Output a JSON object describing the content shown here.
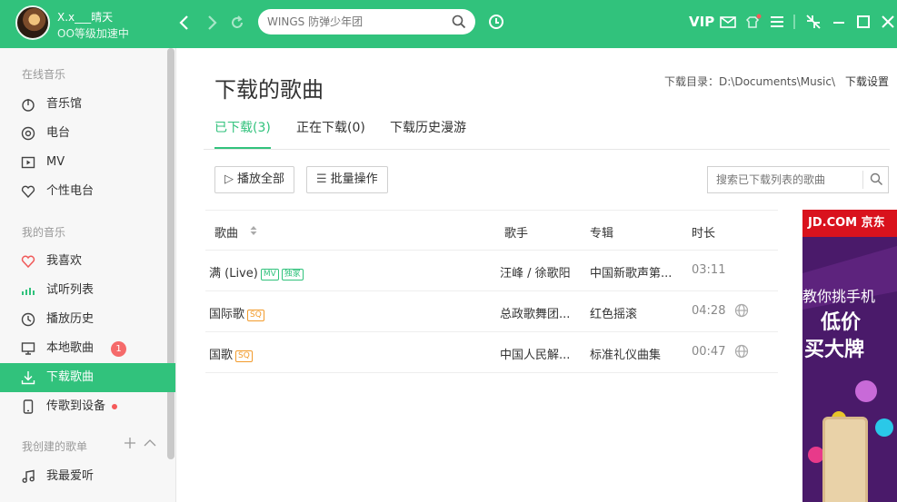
{
  "user": {
    "name": "X.x___晴天",
    "level": "OO等级加速中"
  },
  "search": {
    "placeholder": "WINGS 防弹少年团"
  },
  "topbar": {
    "vip_label": "VIP"
  },
  "sidebar": {
    "online_section": "在线音乐",
    "online_items": [
      {
        "label": "音乐馆",
        "icon": "music-hall-icon"
      },
      {
        "label": "电台",
        "icon": "radio-icon"
      },
      {
        "label": "MV",
        "icon": "mv-icon"
      },
      {
        "label": "个性电台",
        "icon": "heart-radio-icon"
      }
    ],
    "my_section": "我的音乐",
    "my_items": [
      {
        "label": "我喜欢",
        "icon": "heart-icon"
      },
      {
        "label": "试听列表",
        "icon": "bars-icon"
      },
      {
        "label": "播放历史",
        "icon": "clock-icon"
      },
      {
        "label": "本地歌曲",
        "icon": "monitor-icon",
        "badge": "1"
      },
      {
        "label": "下载歌曲",
        "icon": "download-icon",
        "active": true
      },
      {
        "label": "传歌到设备",
        "icon": "device-icon"
      }
    ],
    "created_section": "我创建的歌单",
    "created_items": [
      {
        "label": "我最爱听",
        "icon": "note-icon"
      }
    ]
  },
  "main": {
    "title": "下载的歌曲",
    "download_dir": "下载目录：D:\\Documents\\Music\\",
    "download_settings": "下载设置",
    "tabs": [
      "已下载(3)",
      "正在下载(0)",
      "下载历史漫游"
    ],
    "play_all": "播放全部",
    "batch": "批量操作",
    "list_search_placeholder": "搜索已下载列表的歌曲",
    "columns": {
      "song": "歌曲",
      "artist": "歌手",
      "album": "专辑",
      "duration": "时长"
    },
    "rows": [
      {
        "song": "满 (Live)",
        "tags": [
          "MV",
          "独家"
        ],
        "artist": "汪峰 / 徐歌阳",
        "album": "中国新歌声第...",
        "duration": "03:11"
      },
      {
        "song": "国际歌",
        "tags": [
          "SQ"
        ],
        "artist": "总政歌舞团...",
        "album": "红色摇滚",
        "duration": "04:28"
      },
      {
        "song": "国歌",
        "tags": [
          "SQ"
        ],
        "artist": "中国人民解...",
        "album": "标准礼仪曲集",
        "duration": "00:47"
      }
    ]
  },
  "ad": {
    "brand": "JD.COM 京东",
    "line1": "教你挑手机",
    "line2": "低价",
    "line3": "买大牌"
  },
  "colors": {
    "accent": "#31c27c",
    "badge": "#f56a6a",
    "sq_tag": "#f29b2c"
  }
}
